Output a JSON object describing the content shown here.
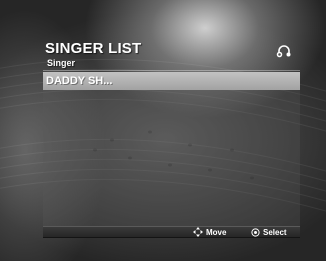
{
  "header": {
    "title": "SINGER LIST",
    "subtitle": "Singer",
    "icon": "headphone-icon"
  },
  "list": {
    "items": [
      {
        "label": "DADDY SH...",
        "selected": true
      }
    ]
  },
  "footer": {
    "hints": [
      {
        "icon": "move-arrows-icon",
        "label": "Move"
      },
      {
        "icon": "select-circle-icon",
        "label": "Select"
      }
    ]
  },
  "colors": {
    "highlight": "#b2b2b2",
    "text": "#ffffff",
    "footer_bar": "#2e2e2e"
  }
}
